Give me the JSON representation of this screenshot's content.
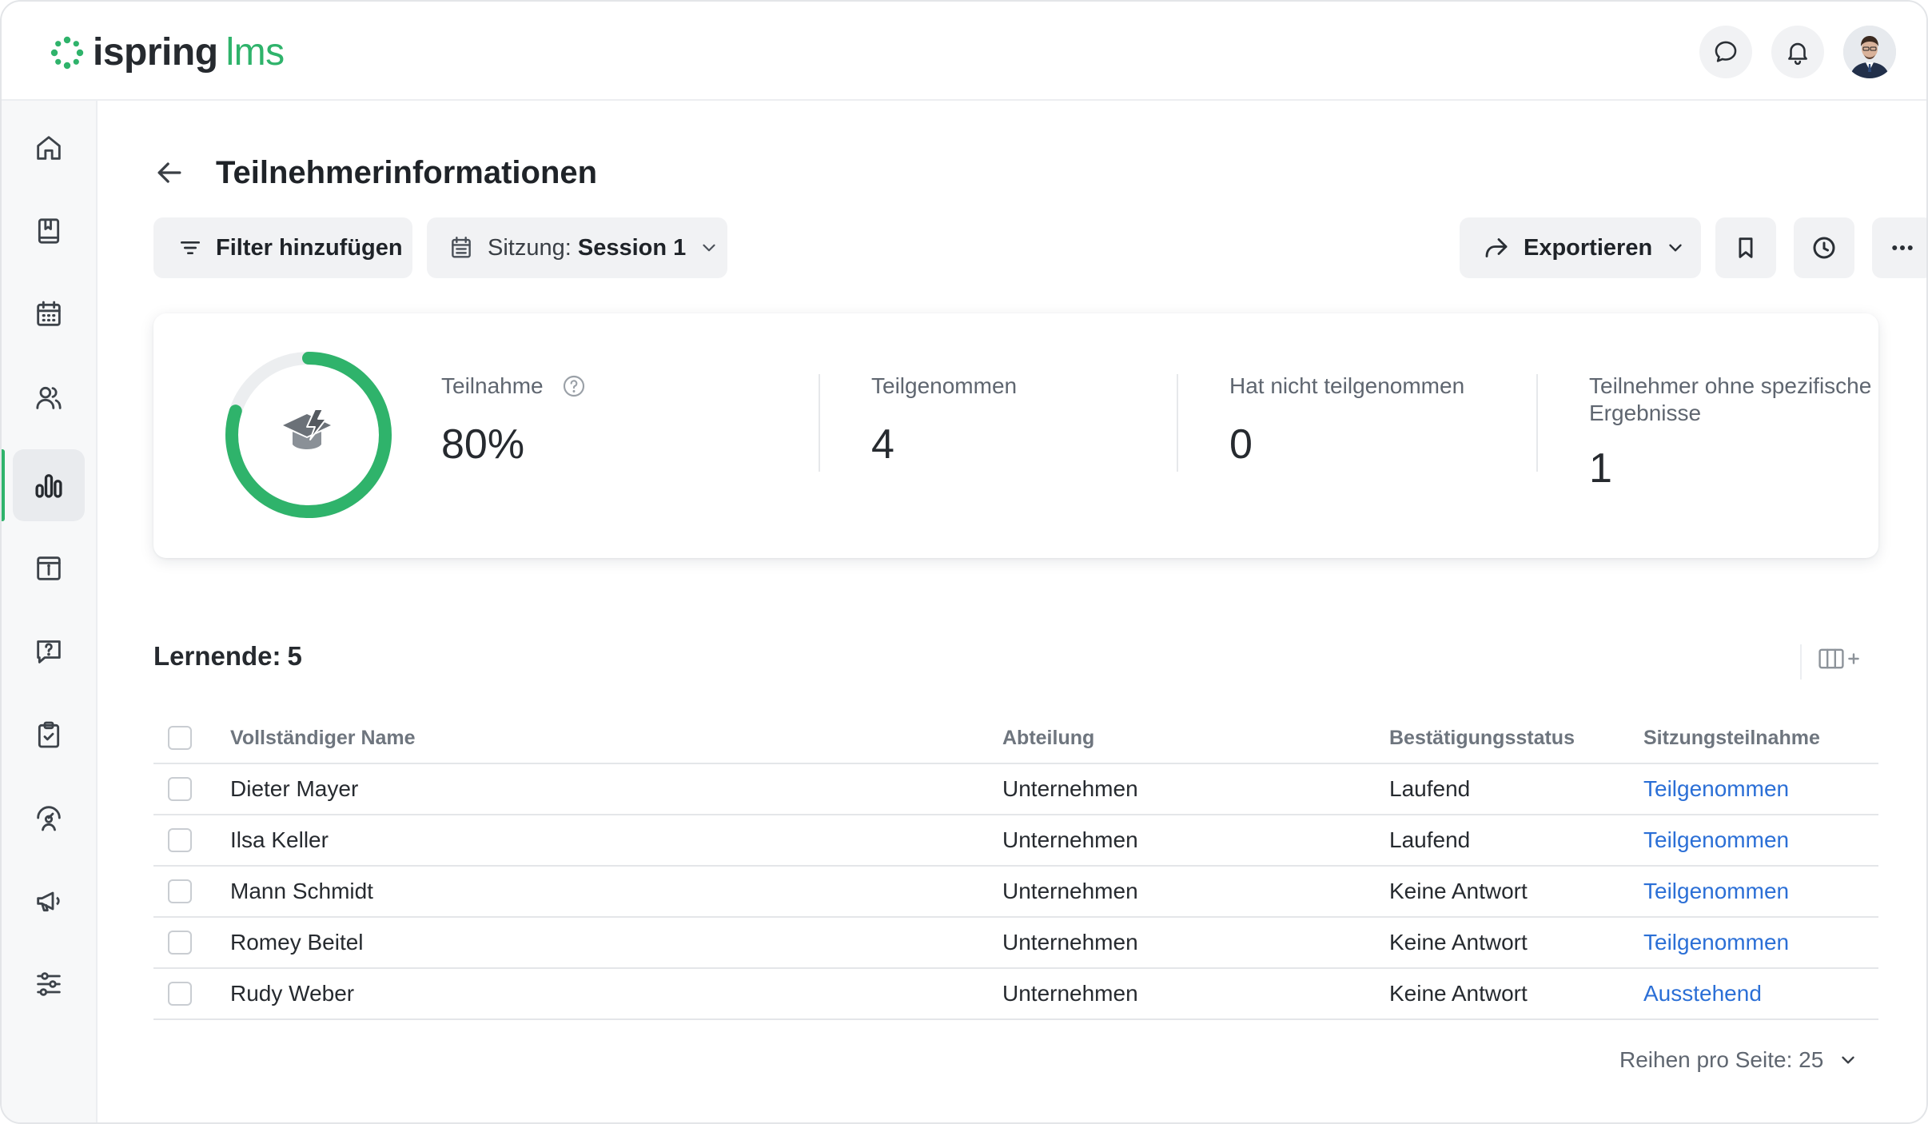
{
  "app": {
    "logo_word_1": "ispring",
    "logo_word_2": "lms",
    "brand_color": "#2fb36b",
    "link_color": "#2b6fd6"
  },
  "topbar": {
    "icons": [
      "chat-icon",
      "bell-icon",
      "user-avatar"
    ]
  },
  "sidebar": {
    "items": [
      {
        "icon": "home-icon",
        "active": false
      },
      {
        "icon": "book-icon",
        "active": false
      },
      {
        "icon": "calendar-icon",
        "active": false
      },
      {
        "icon": "users-icon",
        "active": false
      },
      {
        "icon": "reports-chart-icon",
        "active": true
      },
      {
        "icon": "info-card-icon",
        "active": false
      },
      {
        "icon": "question-chat-icon",
        "active": false
      },
      {
        "icon": "clipboard-check-icon",
        "active": false
      },
      {
        "icon": "gauge-user-icon",
        "active": false
      },
      {
        "icon": "megaphone-icon",
        "active": false
      },
      {
        "icon": "sliders-icon",
        "active": false
      }
    ]
  },
  "header": {
    "title": "Teilnehmerinformationen"
  },
  "toolbar": {
    "filter_label": "Filter hinzufügen",
    "session_label": "Sitzung:",
    "session_value": "Session 1",
    "export_label": "Exportieren"
  },
  "stats": {
    "participation_label": "Teilnahme",
    "participation_value": "80%",
    "participation_fraction": 0.8,
    "participated_label": "Teilgenommen",
    "participated_value": "4",
    "not_participated_label": "Hat nicht teilgenommen",
    "not_participated_value": "0",
    "no_results_label": "Teilnehmer ohne spezifische Ergebnisse",
    "no_results_value": "1"
  },
  "learners": {
    "title": "Lernende:",
    "count": "5"
  },
  "table": {
    "columns": [
      "Vollständiger Name",
      "Abteilung",
      "Bestätigungsstatus",
      "Sitzungsteilnahme"
    ],
    "rows": [
      {
        "name": "Dieter Mayer",
        "dept": "Unternehmen",
        "status": "Laufend",
        "session": "Teilgenommen"
      },
      {
        "name": "Ilsa Keller",
        "dept": "Unternehmen",
        "status": "Laufend",
        "session": "Teilgenommen"
      },
      {
        "name": "Mann Schmidt",
        "dept": "Unternehmen",
        "status": "Keine Antwort",
        "session": "Teilgenommen"
      },
      {
        "name": "Romey Beitel",
        "dept": "Unternehmen",
        "status": "Keine Antwort",
        "session": "Teilgenommen"
      },
      {
        "name": "Rudy Weber",
        "dept": "Unternehmen",
        "status": "Keine Antwort",
        "session": "Ausstehend"
      }
    ]
  },
  "pager": {
    "rows_per_page_label": "Reihen pro Seite:",
    "rows_per_page_value": "25"
  }
}
